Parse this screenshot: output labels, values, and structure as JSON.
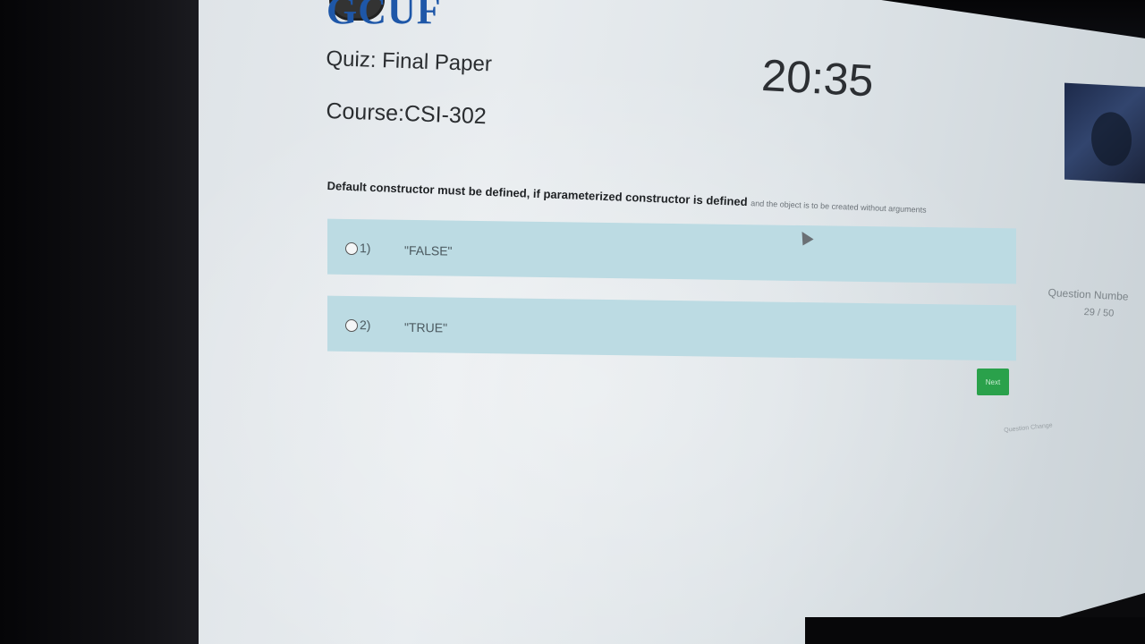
{
  "header": {
    "logo_text": "GCUF",
    "quiz_title": "Quiz: Final Paper",
    "course": "Course:CSI-302",
    "timer": "20:35"
  },
  "question": {
    "text_main": "Default constructor must be defined, if parameterized constructor is defined",
    "text_faded": "and the object is to be created without arguments",
    "options": [
      {
        "number": "1)",
        "label": "\"FALSE\""
      },
      {
        "number": "2)",
        "label": "\"TRUE\""
      }
    ]
  },
  "sidebar": {
    "question_number_label": "Question Numbe",
    "question_number_value": "29 / 50"
  },
  "actions": {
    "next_label": "Next"
  },
  "footer": {
    "link_text": "Question Change"
  },
  "colors": {
    "option_bg": "#bcdbe3",
    "next_button": "#2aa14b",
    "logo_blue": "#1e57a8"
  }
}
